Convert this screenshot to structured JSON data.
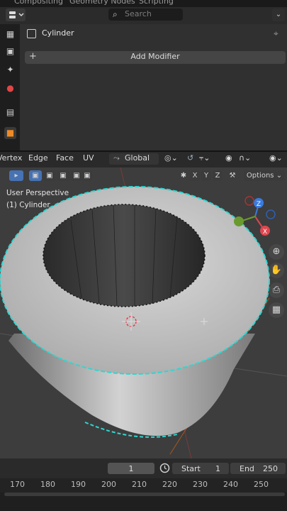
{
  "top_tabs": [
    "Compositing",
    "Geometry Nodes",
    "Scripting"
  ],
  "properties": {
    "search_placeholder": "Search",
    "object_name": "Cylinder",
    "add_modifier_label": "Add Modifier",
    "sidebar_tabs": [
      "tool-icon",
      "render-icon",
      "output-icon",
      "view-layer-icon",
      "scene-icon",
      "world-icon",
      "collection-icon",
      "object-icon"
    ]
  },
  "viewport": {
    "menus": [
      "Vertex",
      "Edge",
      "Face",
      "UV"
    ],
    "orientation": "Global",
    "mirror_axes": [
      "X",
      "Y",
      "Z"
    ],
    "options_label": "Options",
    "perspective_label": "User Perspective",
    "object_label": "(1) Cylinder",
    "gizmo_axes": {
      "x": "X",
      "y": "Y",
      "z": "Z"
    },
    "colors": {
      "selection_edge": "#2fd6d0",
      "background": "#3d3d3d",
      "axis_x": "#e0474f",
      "axis_y": "#6a9a2e",
      "axis_z": "#3a7be0"
    }
  },
  "timeline": {
    "current_frame": "1",
    "start_label": "Start",
    "start_value": "1",
    "end_label": "End",
    "end_value": "250",
    "ruler_ticks": [
      "170",
      "180",
      "190",
      "200",
      "210",
      "220",
      "230",
      "240",
      "250"
    ]
  }
}
